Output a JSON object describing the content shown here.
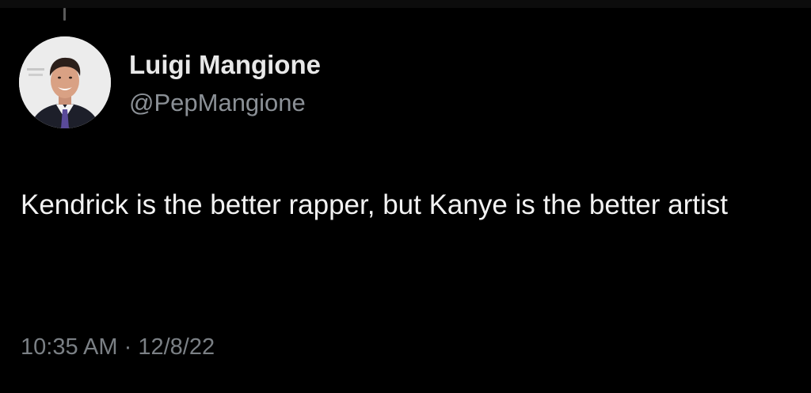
{
  "tweet": {
    "author_name": "Luigi Mangione",
    "author_handle": "@PepMangione",
    "text": "Kendrick is the better rapper, but Kanye is the better artist",
    "time": "10:35 AM",
    "separator": "·",
    "date": "12/8/22"
  },
  "icons": {
    "avatar": "profile-photo"
  },
  "colors": {
    "background": "#000000",
    "name": "#e8e8e8",
    "handle": "#8b9096",
    "text": "#f2f2f2",
    "timestamp": "#7b8085"
  }
}
